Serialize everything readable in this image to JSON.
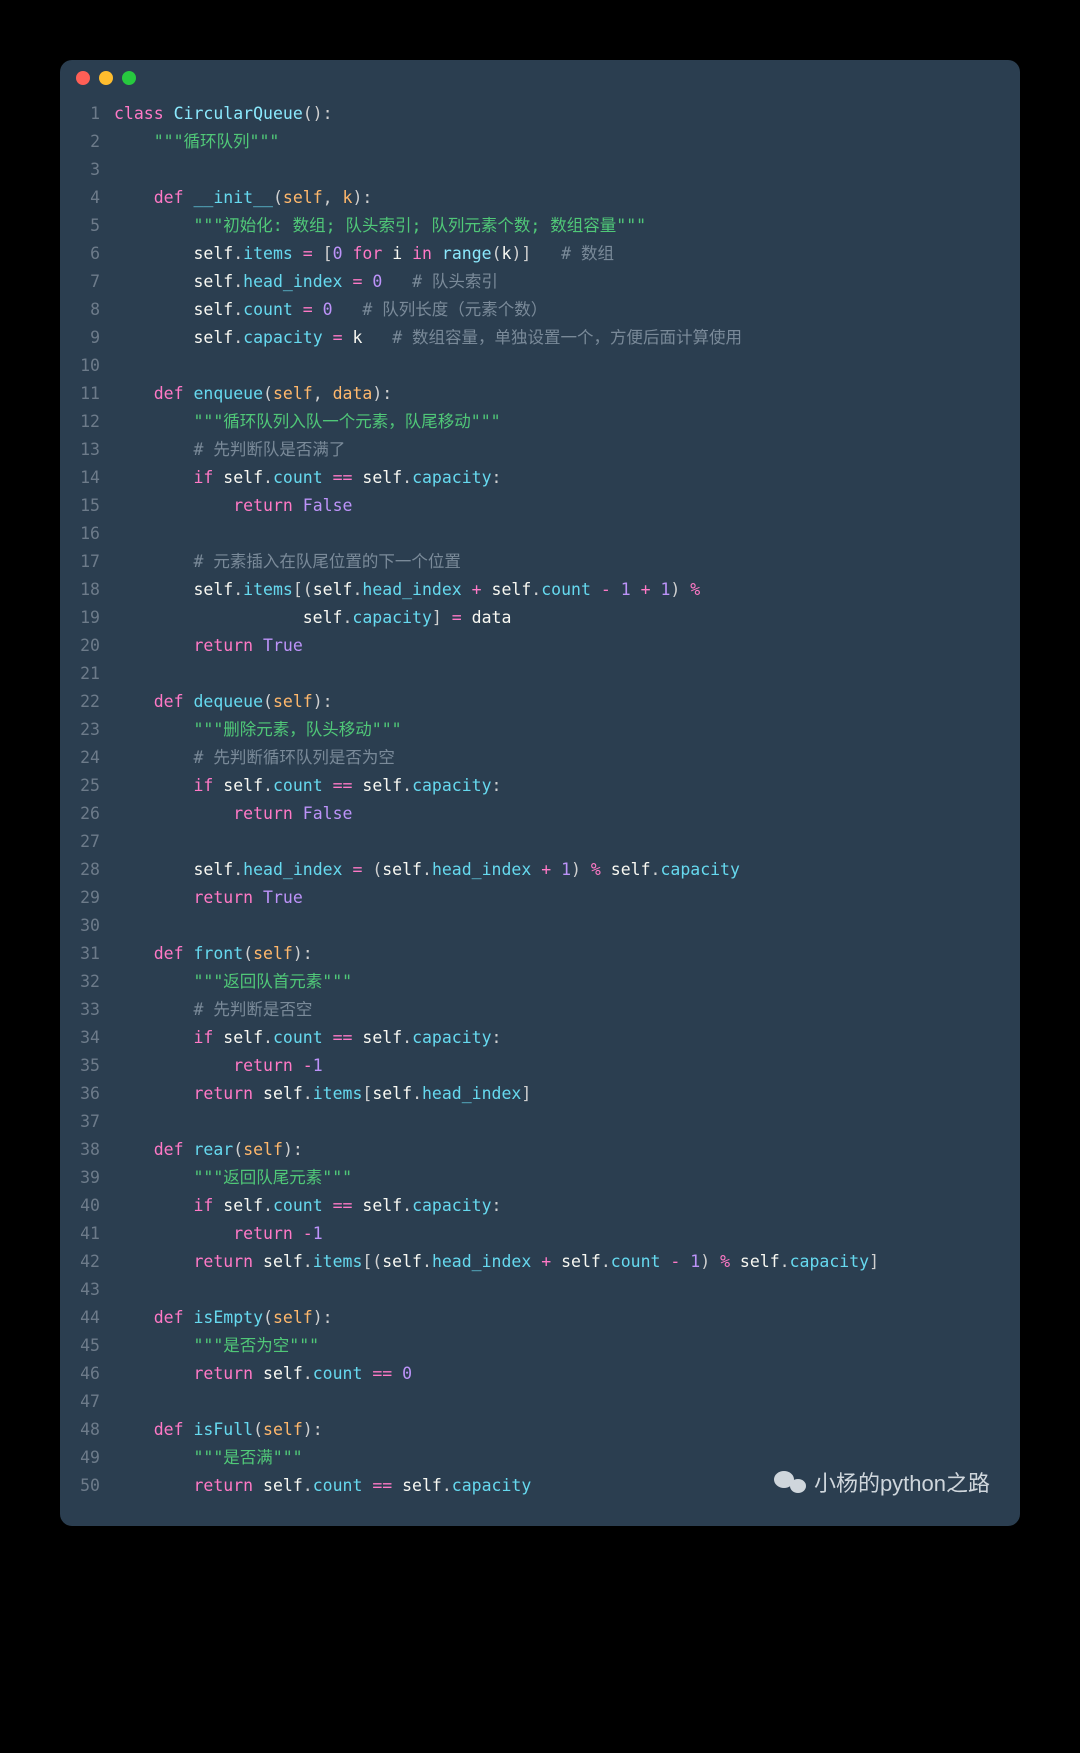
{
  "watermark": "小杨的python之路",
  "code": [
    {
      "n": 1,
      "t": [
        [
          "keyword",
          "class "
        ],
        [
          "classname",
          "CircularQueue"
        ],
        [
          "punct",
          "():"
        ]
      ]
    },
    {
      "n": 2,
      "t": [
        [
          "plain",
          "    "
        ],
        [
          "docstring",
          "\"\"\"循环队列\"\"\""
        ]
      ]
    },
    {
      "n": 3,
      "t": [
        [
          "plain",
          ""
        ]
      ]
    },
    {
      "n": 4,
      "t": [
        [
          "plain",
          "    "
        ],
        [
          "def",
          "def "
        ],
        [
          "funcname",
          "__init__"
        ],
        [
          "punct",
          "("
        ],
        [
          "param",
          "self"
        ],
        [
          "punct",
          ", "
        ],
        [
          "param",
          "k"
        ],
        [
          "punct",
          "):"
        ]
      ]
    },
    {
      "n": 5,
      "t": [
        [
          "plain",
          "        "
        ],
        [
          "docstring",
          "\"\"\"初始化: 数组; 队头索引; 队列元素个数; 数组容量\"\"\""
        ]
      ]
    },
    {
      "n": 6,
      "t": [
        [
          "plain",
          "        self"
        ],
        [
          "punct",
          "."
        ],
        [
          "attr",
          "items"
        ],
        [
          "plain",
          " "
        ],
        [
          "op",
          "="
        ],
        [
          "plain",
          " "
        ],
        [
          "punct",
          "["
        ],
        [
          "number",
          "0"
        ],
        [
          "plain",
          " "
        ],
        [
          "keyword",
          "for"
        ],
        [
          "plain",
          " i "
        ],
        [
          "keyword",
          "in"
        ],
        [
          "plain",
          " "
        ],
        [
          "builtin",
          "range"
        ],
        [
          "punct",
          "("
        ],
        [
          "plain",
          "k"
        ],
        [
          "punct",
          ")]"
        ],
        [
          "plain",
          "   "
        ],
        [
          "comment",
          "# 数组"
        ]
      ]
    },
    {
      "n": 7,
      "t": [
        [
          "plain",
          "        self"
        ],
        [
          "punct",
          "."
        ],
        [
          "attr",
          "head_index"
        ],
        [
          "plain",
          " "
        ],
        [
          "op",
          "="
        ],
        [
          "plain",
          " "
        ],
        [
          "number",
          "0"
        ],
        [
          "plain",
          "   "
        ],
        [
          "comment",
          "# 队头索引"
        ]
      ]
    },
    {
      "n": 8,
      "t": [
        [
          "plain",
          "        self"
        ],
        [
          "punct",
          "."
        ],
        [
          "attr",
          "count"
        ],
        [
          "plain",
          " "
        ],
        [
          "op",
          "="
        ],
        [
          "plain",
          " "
        ],
        [
          "number",
          "0"
        ],
        [
          "plain",
          "   "
        ],
        [
          "comment",
          "# 队列长度（元素个数）"
        ]
      ]
    },
    {
      "n": 9,
      "t": [
        [
          "plain",
          "        self"
        ],
        [
          "punct",
          "."
        ],
        [
          "attr",
          "capacity"
        ],
        [
          "plain",
          " "
        ],
        [
          "op",
          "="
        ],
        [
          "plain",
          " k   "
        ],
        [
          "comment",
          "# 数组容量，单独设置一个，方便后面计算使用"
        ]
      ]
    },
    {
      "n": 10,
      "t": [
        [
          "plain",
          ""
        ]
      ]
    },
    {
      "n": 11,
      "t": [
        [
          "plain",
          "    "
        ],
        [
          "def",
          "def "
        ],
        [
          "funcname",
          "enqueue"
        ],
        [
          "punct",
          "("
        ],
        [
          "param",
          "self"
        ],
        [
          "punct",
          ", "
        ],
        [
          "param",
          "data"
        ],
        [
          "punct",
          "):"
        ]
      ]
    },
    {
      "n": 12,
      "t": [
        [
          "plain",
          "        "
        ],
        [
          "docstring",
          "\"\"\"循环队列入队一个元素，队尾移动\"\"\""
        ]
      ]
    },
    {
      "n": 13,
      "t": [
        [
          "plain",
          "        "
        ],
        [
          "comment",
          "# 先判断队是否满了"
        ]
      ]
    },
    {
      "n": 14,
      "t": [
        [
          "plain",
          "        "
        ],
        [
          "keyword",
          "if"
        ],
        [
          "plain",
          " self"
        ],
        [
          "punct",
          "."
        ],
        [
          "attr",
          "count"
        ],
        [
          "plain",
          " "
        ],
        [
          "op",
          "=="
        ],
        [
          "plain",
          " self"
        ],
        [
          "punct",
          "."
        ],
        [
          "attr",
          "capacity"
        ],
        [
          "punct",
          ":"
        ]
      ]
    },
    {
      "n": 15,
      "t": [
        [
          "plain",
          "            "
        ],
        [
          "keyword",
          "return"
        ],
        [
          "plain",
          " "
        ],
        [
          "bool",
          "False"
        ]
      ]
    },
    {
      "n": 16,
      "t": [
        [
          "plain",
          ""
        ]
      ]
    },
    {
      "n": 17,
      "t": [
        [
          "plain",
          "        "
        ],
        [
          "comment",
          "# 元素插入在队尾位置的下一个位置"
        ]
      ]
    },
    {
      "n": 18,
      "t": [
        [
          "plain",
          "        self"
        ],
        [
          "punct",
          "."
        ],
        [
          "attr",
          "items"
        ],
        [
          "punct",
          "[("
        ],
        [
          "plain",
          "self"
        ],
        [
          "punct",
          "."
        ],
        [
          "attr",
          "head_index"
        ],
        [
          "plain",
          " "
        ],
        [
          "op",
          "+"
        ],
        [
          "plain",
          " self"
        ],
        [
          "punct",
          "."
        ],
        [
          "attr",
          "count"
        ],
        [
          "plain",
          " "
        ],
        [
          "op",
          "-"
        ],
        [
          "plain",
          " "
        ],
        [
          "number",
          "1"
        ],
        [
          "plain",
          " "
        ],
        [
          "op",
          "+"
        ],
        [
          "plain",
          " "
        ],
        [
          "number",
          "1"
        ],
        [
          "punct",
          ")"
        ],
        [
          "plain",
          " "
        ],
        [
          "op",
          "%"
        ]
      ]
    },
    {
      "n": 19,
      "t": [
        [
          "plain",
          "                   self"
        ],
        [
          "punct",
          "."
        ],
        [
          "attr",
          "capacity"
        ],
        [
          "punct",
          "]"
        ],
        [
          "plain",
          " "
        ],
        [
          "op",
          "="
        ],
        [
          "plain",
          " data"
        ]
      ]
    },
    {
      "n": 20,
      "t": [
        [
          "plain",
          "        "
        ],
        [
          "keyword",
          "return"
        ],
        [
          "plain",
          " "
        ],
        [
          "bool",
          "True"
        ]
      ]
    },
    {
      "n": 21,
      "t": [
        [
          "plain",
          ""
        ]
      ]
    },
    {
      "n": 22,
      "t": [
        [
          "plain",
          "    "
        ],
        [
          "def",
          "def "
        ],
        [
          "funcname",
          "dequeue"
        ],
        [
          "punct",
          "("
        ],
        [
          "param",
          "self"
        ],
        [
          "punct",
          "):"
        ]
      ]
    },
    {
      "n": 23,
      "t": [
        [
          "plain",
          "        "
        ],
        [
          "docstring",
          "\"\"\"删除元素，队头移动\"\"\""
        ]
      ]
    },
    {
      "n": 24,
      "t": [
        [
          "plain",
          "        "
        ],
        [
          "comment",
          "# 先判断循环队列是否为空"
        ]
      ]
    },
    {
      "n": 25,
      "t": [
        [
          "plain",
          "        "
        ],
        [
          "keyword",
          "if"
        ],
        [
          "plain",
          " self"
        ],
        [
          "punct",
          "."
        ],
        [
          "attr",
          "count"
        ],
        [
          "plain",
          " "
        ],
        [
          "op",
          "=="
        ],
        [
          "plain",
          " self"
        ],
        [
          "punct",
          "."
        ],
        [
          "attr",
          "capacity"
        ],
        [
          "punct",
          ":"
        ]
      ]
    },
    {
      "n": 26,
      "t": [
        [
          "plain",
          "            "
        ],
        [
          "keyword",
          "return"
        ],
        [
          "plain",
          " "
        ],
        [
          "bool",
          "False"
        ]
      ]
    },
    {
      "n": 27,
      "t": [
        [
          "plain",
          ""
        ]
      ]
    },
    {
      "n": 28,
      "t": [
        [
          "plain",
          "        self"
        ],
        [
          "punct",
          "."
        ],
        [
          "attr",
          "head_index"
        ],
        [
          "plain",
          " "
        ],
        [
          "op",
          "="
        ],
        [
          "plain",
          " "
        ],
        [
          "punct",
          "("
        ],
        [
          "plain",
          "self"
        ],
        [
          "punct",
          "."
        ],
        [
          "attr",
          "head_index"
        ],
        [
          "plain",
          " "
        ],
        [
          "op",
          "+"
        ],
        [
          "plain",
          " "
        ],
        [
          "number",
          "1"
        ],
        [
          "punct",
          ")"
        ],
        [
          "plain",
          " "
        ],
        [
          "op",
          "%"
        ],
        [
          "plain",
          " self"
        ],
        [
          "punct",
          "."
        ],
        [
          "attr",
          "capacity"
        ]
      ]
    },
    {
      "n": 29,
      "t": [
        [
          "plain",
          "        "
        ],
        [
          "keyword",
          "return"
        ],
        [
          "plain",
          " "
        ],
        [
          "bool",
          "True"
        ]
      ]
    },
    {
      "n": 30,
      "t": [
        [
          "plain",
          ""
        ]
      ]
    },
    {
      "n": 31,
      "t": [
        [
          "plain",
          "    "
        ],
        [
          "def",
          "def "
        ],
        [
          "funcname",
          "front"
        ],
        [
          "punct",
          "("
        ],
        [
          "param",
          "self"
        ],
        [
          "punct",
          "):"
        ]
      ]
    },
    {
      "n": 32,
      "t": [
        [
          "plain",
          "        "
        ],
        [
          "docstring",
          "\"\"\"返回队首元素\"\"\""
        ]
      ]
    },
    {
      "n": 33,
      "t": [
        [
          "plain",
          "        "
        ],
        [
          "comment",
          "# 先判断是否空"
        ]
      ]
    },
    {
      "n": 34,
      "t": [
        [
          "plain",
          "        "
        ],
        [
          "keyword",
          "if"
        ],
        [
          "plain",
          " self"
        ],
        [
          "punct",
          "."
        ],
        [
          "attr",
          "count"
        ],
        [
          "plain",
          " "
        ],
        [
          "op",
          "=="
        ],
        [
          "plain",
          " self"
        ],
        [
          "punct",
          "."
        ],
        [
          "attr",
          "capacity"
        ],
        [
          "punct",
          ":"
        ]
      ]
    },
    {
      "n": 35,
      "t": [
        [
          "plain",
          "            "
        ],
        [
          "keyword",
          "return"
        ],
        [
          "plain",
          " "
        ],
        [
          "op",
          "-"
        ],
        [
          "number",
          "1"
        ]
      ]
    },
    {
      "n": 36,
      "t": [
        [
          "plain",
          "        "
        ],
        [
          "keyword",
          "return"
        ],
        [
          "plain",
          " self"
        ],
        [
          "punct",
          "."
        ],
        [
          "attr",
          "items"
        ],
        [
          "punct",
          "["
        ],
        [
          "plain",
          "self"
        ],
        [
          "punct",
          "."
        ],
        [
          "attr",
          "head_index"
        ],
        [
          "punct",
          "]"
        ]
      ]
    },
    {
      "n": 37,
      "t": [
        [
          "plain",
          ""
        ]
      ]
    },
    {
      "n": 38,
      "t": [
        [
          "plain",
          "    "
        ],
        [
          "def",
          "def "
        ],
        [
          "funcname",
          "rear"
        ],
        [
          "punct",
          "("
        ],
        [
          "param",
          "self"
        ],
        [
          "punct",
          "):"
        ]
      ]
    },
    {
      "n": 39,
      "t": [
        [
          "plain",
          "        "
        ],
        [
          "docstring",
          "\"\"\"返回队尾元素\"\"\""
        ]
      ]
    },
    {
      "n": 40,
      "t": [
        [
          "plain",
          "        "
        ],
        [
          "keyword",
          "if"
        ],
        [
          "plain",
          " self"
        ],
        [
          "punct",
          "."
        ],
        [
          "attr",
          "count"
        ],
        [
          "plain",
          " "
        ],
        [
          "op",
          "=="
        ],
        [
          "plain",
          " self"
        ],
        [
          "punct",
          "."
        ],
        [
          "attr",
          "capacity"
        ],
        [
          "punct",
          ":"
        ]
      ]
    },
    {
      "n": 41,
      "t": [
        [
          "plain",
          "            "
        ],
        [
          "keyword",
          "return"
        ],
        [
          "plain",
          " "
        ],
        [
          "op",
          "-"
        ],
        [
          "number",
          "1"
        ]
      ]
    },
    {
      "n": 42,
      "t": [
        [
          "plain",
          "        "
        ],
        [
          "keyword",
          "return"
        ],
        [
          "plain",
          " self"
        ],
        [
          "punct",
          "."
        ],
        [
          "attr",
          "items"
        ],
        [
          "punct",
          "[("
        ],
        [
          "plain",
          "self"
        ],
        [
          "punct",
          "."
        ],
        [
          "attr",
          "head_index"
        ],
        [
          "plain",
          " "
        ],
        [
          "op",
          "+"
        ],
        [
          "plain",
          " self"
        ],
        [
          "punct",
          "."
        ],
        [
          "attr",
          "count"
        ],
        [
          "plain",
          " "
        ],
        [
          "op",
          "-"
        ],
        [
          "plain",
          " "
        ],
        [
          "number",
          "1"
        ],
        [
          "punct",
          ")"
        ],
        [
          "plain",
          " "
        ],
        [
          "op",
          "%"
        ],
        [
          "plain",
          " self"
        ],
        [
          "punct",
          "."
        ],
        [
          "attr",
          "capacity"
        ],
        [
          "punct",
          "]"
        ]
      ]
    },
    {
      "n": 43,
      "t": [
        [
          "plain",
          ""
        ]
      ]
    },
    {
      "n": 44,
      "t": [
        [
          "plain",
          "    "
        ],
        [
          "def",
          "def "
        ],
        [
          "funcname",
          "isEmpty"
        ],
        [
          "punct",
          "("
        ],
        [
          "param",
          "self"
        ],
        [
          "punct",
          "):"
        ]
      ]
    },
    {
      "n": 45,
      "t": [
        [
          "plain",
          "        "
        ],
        [
          "docstring",
          "\"\"\"是否为空\"\"\""
        ]
      ]
    },
    {
      "n": 46,
      "t": [
        [
          "plain",
          "        "
        ],
        [
          "keyword",
          "return"
        ],
        [
          "plain",
          " self"
        ],
        [
          "punct",
          "."
        ],
        [
          "attr",
          "count"
        ],
        [
          "plain",
          " "
        ],
        [
          "op",
          "=="
        ],
        [
          "plain",
          " "
        ],
        [
          "number",
          "0"
        ]
      ]
    },
    {
      "n": 47,
      "t": [
        [
          "plain",
          ""
        ]
      ]
    },
    {
      "n": 48,
      "t": [
        [
          "plain",
          "    "
        ],
        [
          "def",
          "def "
        ],
        [
          "funcname",
          "isFull"
        ],
        [
          "punct",
          "("
        ],
        [
          "param",
          "self"
        ],
        [
          "punct",
          "):"
        ]
      ]
    },
    {
      "n": 49,
      "t": [
        [
          "plain",
          "        "
        ],
        [
          "docstring",
          "\"\"\"是否满\"\"\""
        ]
      ]
    },
    {
      "n": 50,
      "t": [
        [
          "plain",
          "        "
        ],
        [
          "keyword",
          "return"
        ],
        [
          "plain",
          " self"
        ],
        [
          "punct",
          "."
        ],
        [
          "attr",
          "count"
        ],
        [
          "plain",
          " "
        ],
        [
          "op",
          "=="
        ],
        [
          "plain",
          " self"
        ],
        [
          "punct",
          "."
        ],
        [
          "attr",
          "capacity"
        ]
      ]
    }
  ]
}
